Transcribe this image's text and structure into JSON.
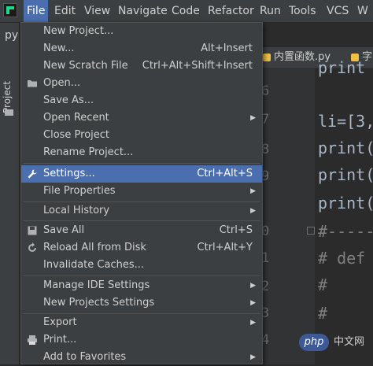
{
  "menubar": {
    "items": [
      "File",
      "Edit",
      "View",
      "Navigate",
      "Code",
      "Refactor",
      "Run",
      "Tools",
      "VCS",
      "W"
    ]
  },
  "toolwindow": {
    "label": "Project",
    "stub": "py"
  },
  "tabs": [
    {
      "label": "内置函数.py"
    },
    {
      "label": "字"
    }
  ],
  "editor": {
    "line_numbers": [
      "5",
      "6",
      "7",
      "8",
      "9",
      "0",
      "1",
      "2",
      "3",
      "4",
      "5"
    ],
    "lines": [
      "print",
      "li=[3,",
      "print(",
      "print(",
      "print(",
      "#-----",
      "# def",
      "#",
      "#"
    ]
  },
  "file_menu": {
    "items": [
      {
        "label": "New Project...",
        "shortcut": "",
        "submenu": false,
        "icon": ""
      },
      {
        "label": "New...",
        "shortcut": "Alt+Insert",
        "submenu": false,
        "icon": ""
      },
      {
        "label": "New Scratch File",
        "shortcut": "Ctrl+Alt+Shift+Insert",
        "submenu": false,
        "icon": ""
      },
      {
        "label": "Open...",
        "shortcut": "",
        "submenu": false,
        "icon": "folder-icon"
      },
      {
        "label": "Save As...",
        "shortcut": "",
        "submenu": false,
        "icon": ""
      },
      {
        "label": "Open Recent",
        "shortcut": "",
        "submenu": true,
        "icon": ""
      },
      {
        "label": "Close Project",
        "shortcut": "",
        "submenu": false,
        "icon": ""
      },
      {
        "label": "Rename Project...",
        "shortcut": "",
        "submenu": false,
        "icon": ""
      },
      {
        "label": "Settings...",
        "shortcut": "Ctrl+Alt+S",
        "submenu": false,
        "icon": "wrench-icon",
        "selected": true
      },
      {
        "label": "File Properties",
        "shortcut": "",
        "submenu": true,
        "icon": ""
      },
      {
        "label": "Local History",
        "shortcut": "",
        "submenu": true,
        "icon": ""
      },
      {
        "label": "Save All",
        "shortcut": "Ctrl+S",
        "submenu": false,
        "icon": "save-icon"
      },
      {
        "label": "Reload All from Disk",
        "shortcut": "Ctrl+Alt+Y",
        "submenu": false,
        "icon": "reload-icon"
      },
      {
        "label": "Invalidate Caches...",
        "shortcut": "",
        "submenu": false,
        "icon": ""
      },
      {
        "label": "Manage IDE Settings",
        "shortcut": "",
        "submenu": true,
        "icon": ""
      },
      {
        "label": "New Projects Settings",
        "shortcut": "",
        "submenu": true,
        "icon": ""
      },
      {
        "label": "Export",
        "shortcut": "",
        "submenu": true,
        "icon": ""
      },
      {
        "label": "Print...",
        "shortcut": "",
        "submenu": false,
        "icon": "print-icon"
      },
      {
        "label": "Add to Favorites",
        "shortcut": "",
        "submenu": true,
        "icon": ""
      }
    ]
  },
  "watermark": {
    "badge": "php",
    "text": "中文网"
  },
  "colors": {
    "selection": "#4b6eaf",
    "menu_bg": "#3c3f41",
    "editor_bg": "#2b2b2b"
  }
}
